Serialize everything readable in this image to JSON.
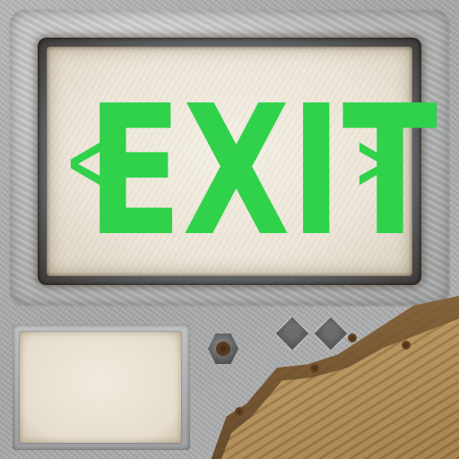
{
  "sign": {
    "text": "EXIT",
    "left_arrow": "<",
    "right_arrow": ">",
    "text_color": "#2fd24a"
  },
  "colors": {
    "panel": "#ece5d7",
    "housing": "#b9bbbd",
    "wood": "#b18d56"
  },
  "icons": {
    "nut": "hex-nut-icon",
    "diamonds": [
      "diamond-stud-icon",
      "diamond-stud-icon"
    ]
  }
}
